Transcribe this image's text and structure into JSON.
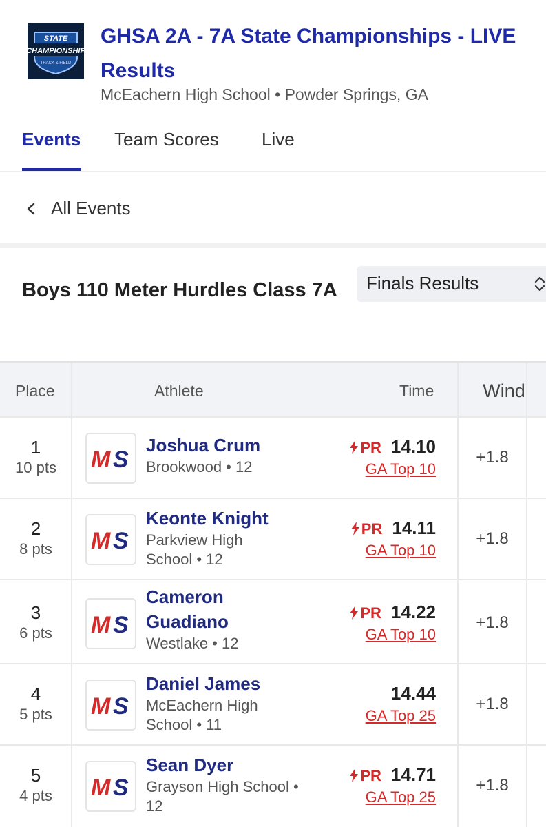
{
  "meet": {
    "title": "GHSA 2A - 7A State Championships - LIVE Results",
    "location": "McEachern High School • Powder Springs, GA",
    "logo_text": "STATE CHAMPIONSHIP"
  },
  "tabs": [
    {
      "label": "Events",
      "active": true
    },
    {
      "label": "Team Scores",
      "active": false
    },
    {
      "label": "Live",
      "active": false
    }
  ],
  "nav": {
    "back_label": "All Events",
    "back_icon": "chevron-left-icon"
  },
  "event": {
    "title": "Boys 110 Meter Hurdles Class 7A",
    "round_select": "Finals Results"
  },
  "table": {
    "headers": {
      "place": "Place",
      "athlete": "Athlete",
      "time": "Time",
      "wind": "Wind"
    },
    "rows": [
      {
        "place": "1",
        "points": "10 pts",
        "name": "Joshua Crum",
        "school": "Brookwood • 12",
        "pr": "PR",
        "time": "14.10",
        "rank": "GA Top 10",
        "wind": "+1.8"
      },
      {
        "place": "2",
        "points": "8 pts",
        "name": "Keonte Knight",
        "school": "Parkview High School • 12",
        "pr": "PR",
        "time": "14.11",
        "rank": "GA Top 10",
        "wind": "+1.8"
      },
      {
        "place": "3",
        "points": "6 pts",
        "name": "Cameron Guadiano",
        "school": "Westlake • 12",
        "pr": "PR",
        "time": "14.22",
        "rank": "GA Top 10",
        "wind": "+1.8"
      },
      {
        "place": "4",
        "points": "5 pts",
        "name": "Daniel James",
        "school": "McEachern High School • 11",
        "pr": "",
        "time": "14.44",
        "rank": "GA Top 25",
        "wind": "+1.8"
      },
      {
        "place": "5",
        "points": "4 pts",
        "name": "Sean Dyer",
        "school": "Grayson High School • 12",
        "pr": "PR",
        "time": "14.71",
        "rank": "GA Top 25",
        "wind": "+1.8"
      }
    ]
  },
  "colors": {
    "brand_blue": "#1f2aa8",
    "pr_red": "#d42a2a",
    "ms_red": "#d42a2a",
    "ms_navy": "#1f2a80"
  }
}
